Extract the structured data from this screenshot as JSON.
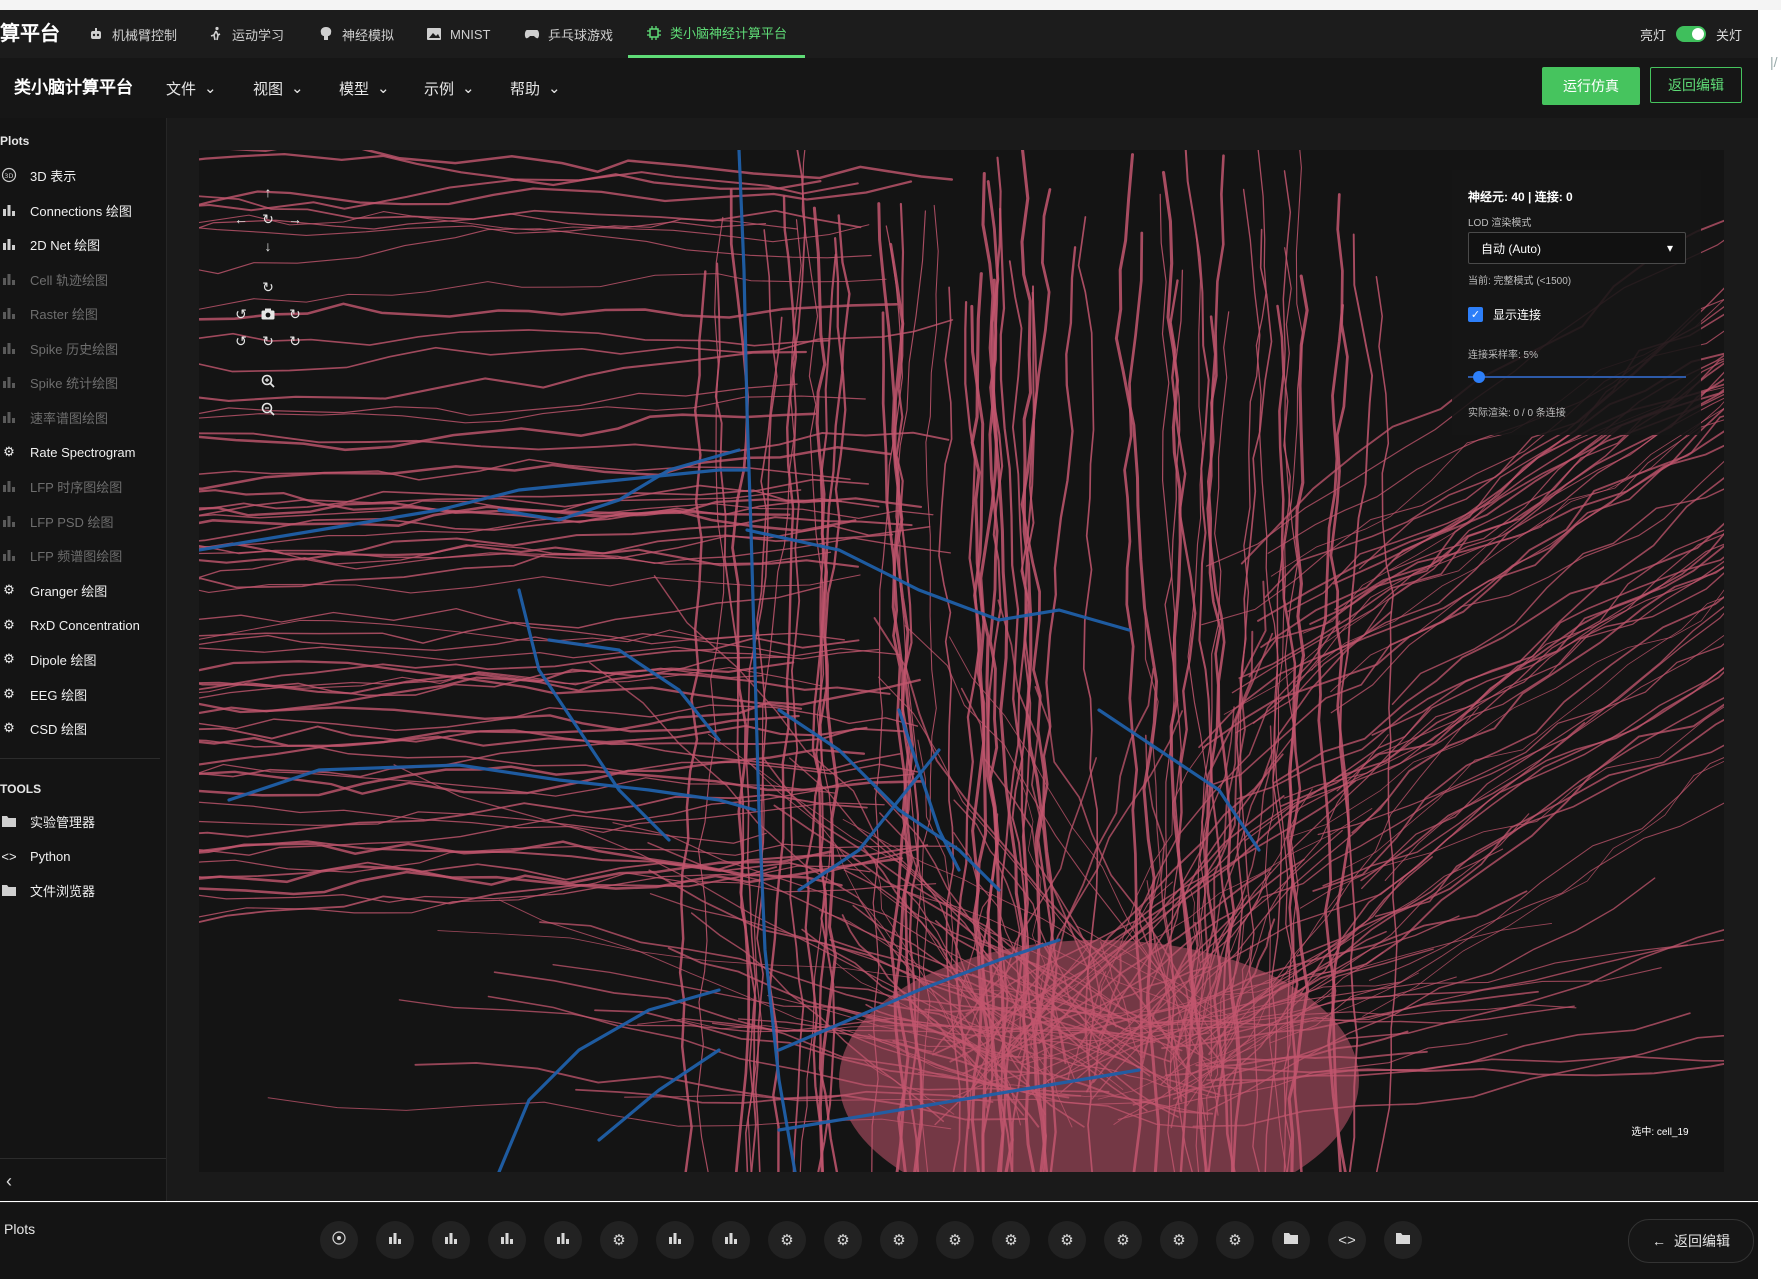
{
  "topbar": {
    "brand": "算平台",
    "tabs": [
      {
        "label": "机械臂控制",
        "icon": "robot-icon"
      },
      {
        "label": "运动学习",
        "icon": "runner-icon"
      },
      {
        "label": "神经模拟",
        "icon": "brain-icon"
      },
      {
        "label": "MNIST",
        "icon": "image-icon"
      },
      {
        "label": "乒乓球游戏",
        "icon": "gamepad-icon"
      },
      {
        "label": "类小脑神经计算平台",
        "icon": "chip-icon",
        "active": true
      }
    ],
    "theme_on": "亮灯",
    "theme_off": "关灯"
  },
  "menubar": {
    "title": "类小脑计算平台",
    "menus": [
      "文件",
      "视图",
      "模型",
      "示例",
      "帮助"
    ],
    "run_label": "运行仿真",
    "back_label": "返回编辑"
  },
  "sidebar": {
    "plots_header": "Plots",
    "plots": [
      {
        "label": "3D 表示",
        "icon": "3d-icon",
        "enabled": true
      },
      {
        "label": "Connections 绘图",
        "icon": "bar-chart-icon",
        "enabled": true
      },
      {
        "label": "2D Net 绘图",
        "icon": "bar-chart-icon",
        "enabled": true
      },
      {
        "label": "Cell 轨迹绘图",
        "icon": "bar-chart-icon",
        "enabled": false
      },
      {
        "label": "Raster 绘图",
        "icon": "bar-chart-icon",
        "enabled": false
      },
      {
        "label": "Spike 历史绘图",
        "icon": "bar-chart-icon",
        "enabled": false
      },
      {
        "label": "Spike 统计绘图",
        "icon": "bar-chart-icon",
        "enabled": false
      },
      {
        "label": "速率谱图绘图",
        "icon": "bar-chart-icon",
        "enabled": false
      },
      {
        "label": "Rate Spectrogram",
        "icon": "gear-icon",
        "enabled": true
      },
      {
        "label": "LFP 时序图绘图",
        "icon": "bar-chart-icon",
        "enabled": false
      },
      {
        "label": "LFP PSD 绘图",
        "icon": "bar-chart-icon",
        "enabled": false
      },
      {
        "label": "LFP 频谱图绘图",
        "icon": "bar-chart-icon",
        "enabled": false
      },
      {
        "label": "Granger 绘图",
        "icon": "gear-icon",
        "enabled": true
      },
      {
        "label": "RxD Concentration",
        "icon": "gear-icon",
        "enabled": true
      },
      {
        "label": "Dipole 绘图",
        "icon": "gear-icon",
        "enabled": true
      },
      {
        "label": "EEG 绘图",
        "icon": "gear-icon",
        "enabled": true
      },
      {
        "label": "CSD 绘图",
        "icon": "gear-icon",
        "enabled": true
      }
    ],
    "tools_header": "TOOLS",
    "tools": [
      {
        "label": "实验管理器",
        "icon": "folder-icon"
      },
      {
        "label": "Python",
        "icon": "code-icon"
      },
      {
        "label": "文件浏览器",
        "icon": "folder-icon"
      }
    ]
  },
  "lod_panel": {
    "stats": "神经元: 40 | 连接: 0",
    "mode_label": "LOD 渲染模式",
    "mode_value": "自动 (Auto)",
    "current": "当前: 完整模式 (<1500)",
    "show_connections": "显示连接",
    "sampling": "连接采样率: 5%",
    "sampling_percent": 5,
    "actual": "实际渲染: 0 / 0 条连接"
  },
  "selected_cell": "选中: cell_19",
  "bottombar": {
    "plots_label": "Plots",
    "tools": [
      "3d-icon",
      "bar-chart-icon",
      "bar-chart-icon",
      "bar-chart-icon",
      "bar-chart-icon",
      "gear-icon",
      "bar-chart-icon",
      "bar-chart-icon",
      "gear-icon",
      "gear-icon",
      "gear-icon",
      "gear-icon",
      "gear-icon",
      "gear-icon",
      "gear-icon",
      "gear-icon",
      "gear-icon",
      "folder-icon",
      "code-icon",
      "folder-icon"
    ],
    "return_label": "返回编辑"
  },
  "colors": {
    "accent": "#46c45e",
    "neuron": "#c2566e",
    "connection": "#1f5fa8"
  }
}
